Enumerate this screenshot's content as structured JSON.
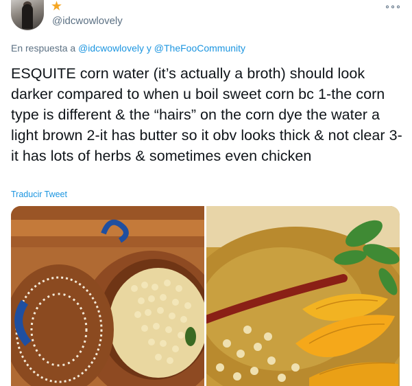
{
  "tweet": {
    "star_icon": "star-icon",
    "handle": "@idcwowlovely",
    "reply_prefix": "En respuesta a",
    "reply_user1": "@idcwowlovely",
    "reply_conj": "y",
    "reply_user2": "@TheFooCommunity",
    "text": "ESQUITE corn water (it’s actually a broth) should look darker compared to when u boil sweet corn bc 1-the corn type is different & the “hairs” on the corn dye the water a light brown 2-it has butter so it obv looks thick & not clear 3-it has lots of herbs & sometimes even chicken",
    "translate_label": "Traducir Tweet"
  },
  "colors": {
    "link": "#1b95e0",
    "muted": "#5b7083",
    "star": "#f5a623"
  }
}
